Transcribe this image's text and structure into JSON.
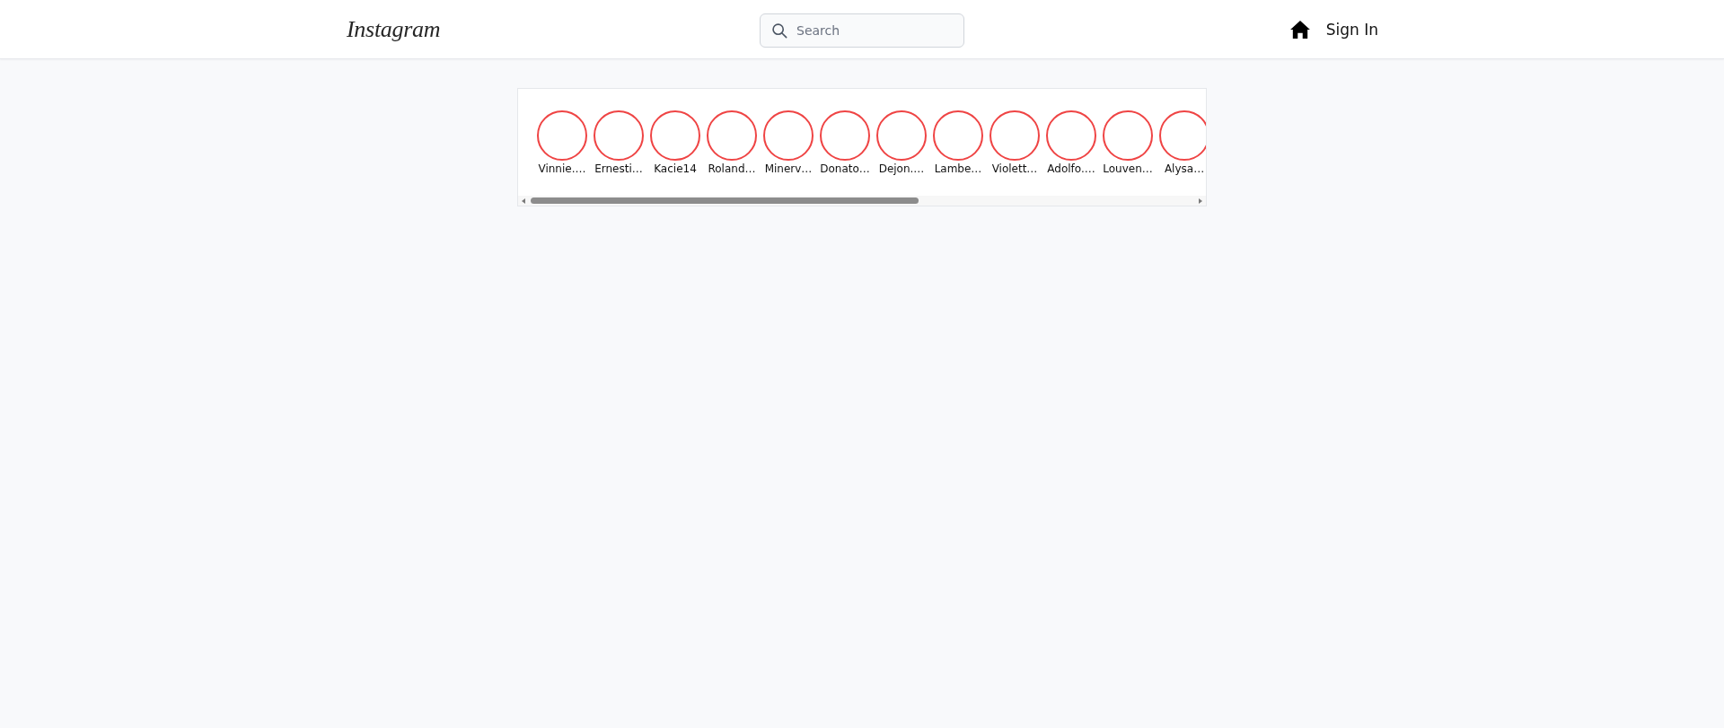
{
  "header": {
    "logo": "Instagram",
    "search": {
      "placeholder": "Search"
    },
    "sign_in": "Sign In"
  },
  "stories": [
    {
      "username": "Vinnie.…"
    },
    {
      "username": "Ernesti…"
    },
    {
      "username": "Kacie14"
    },
    {
      "username": "Roland…"
    },
    {
      "username": "Minerv…"
    },
    {
      "username": "Donato…"
    },
    {
      "username": "Dejon.…"
    },
    {
      "username": "Lambe…"
    },
    {
      "username": "Violett…"
    },
    {
      "username": "Adolfo.…"
    },
    {
      "username": "Louven…"
    },
    {
      "username": "Alysa…"
    }
  ]
}
